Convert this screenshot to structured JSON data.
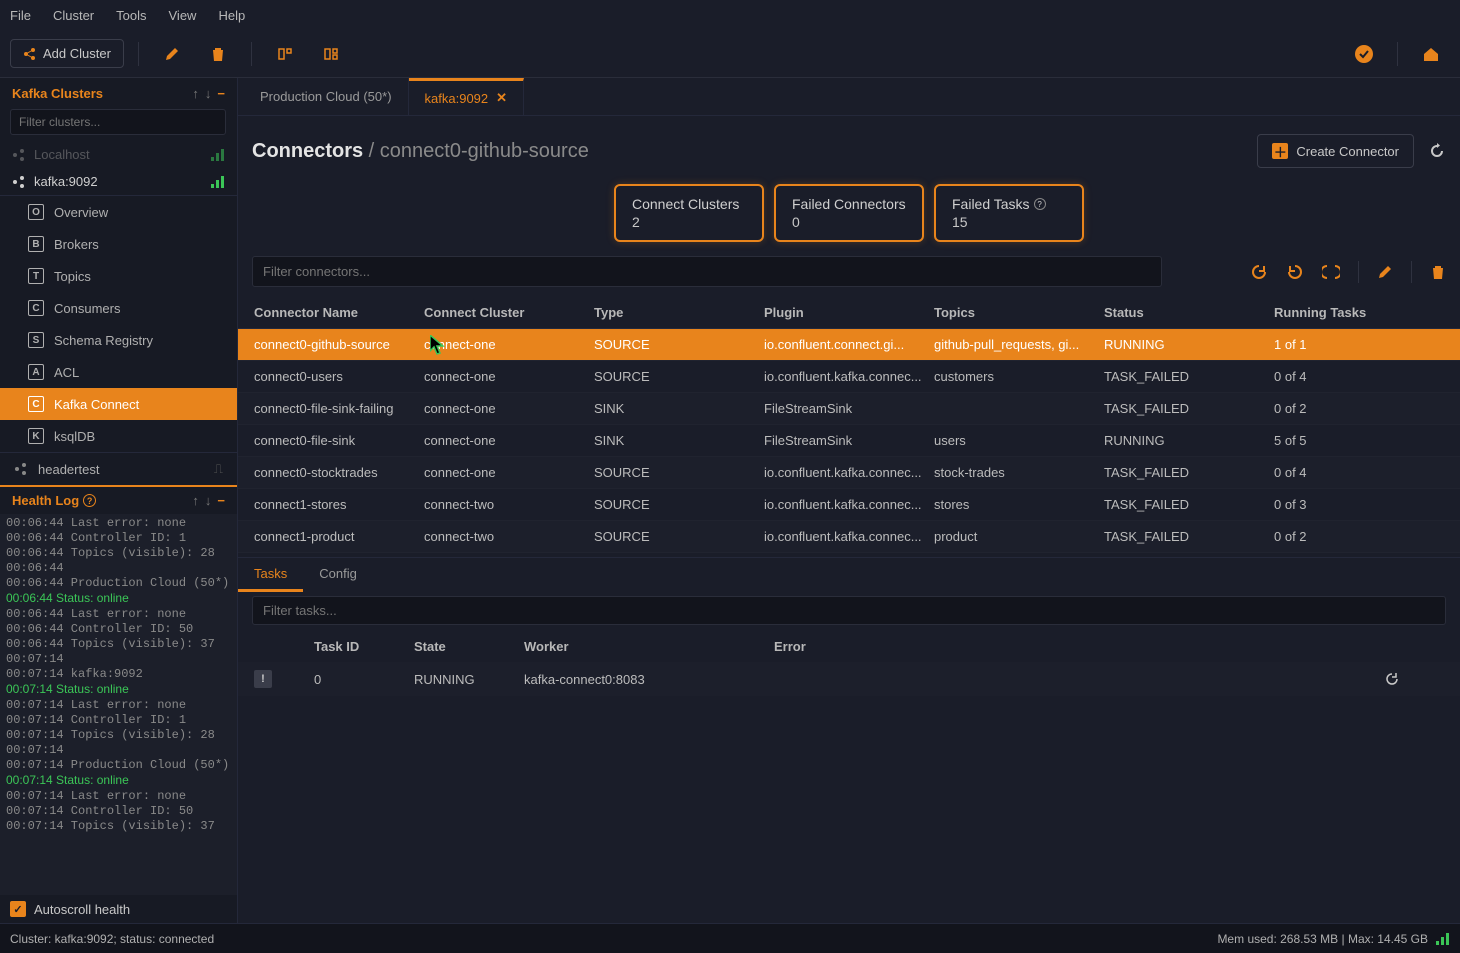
{
  "menu": {
    "file": "File",
    "cluster": "Cluster",
    "tools": "Tools",
    "view": "View",
    "help": "Help"
  },
  "toolbar": {
    "add_cluster": "Add Cluster"
  },
  "sidebar": {
    "title": "Kafka Clusters",
    "filter_placeholder": "Filter clusters...",
    "items": [
      {
        "name": "Localhost",
        "faded": true
      },
      {
        "name": "kafka:9092",
        "active": true
      }
    ],
    "tree": [
      {
        "badge": "O",
        "label": "Overview"
      },
      {
        "badge": "B",
        "label": "Brokers"
      },
      {
        "badge": "T",
        "label": "Topics"
      },
      {
        "badge": "C",
        "label": "Consumers"
      },
      {
        "badge": "S",
        "label": "Schema Registry"
      },
      {
        "badge": "A",
        "label": "ACL"
      },
      {
        "badge": "C",
        "label": "Kafka Connect",
        "selected": true
      },
      {
        "badge": "K",
        "label": "ksqlDB"
      }
    ],
    "headertest": "headertest",
    "health_title": "Health Log",
    "autoscroll": "Autoscroll health"
  },
  "health_log": [
    "00:06:44 Last error: none",
    "00:06:44 Controller ID: 1",
    "00:06:44 Topics (visible): 28",
    "00:06:44",
    "00:06:44 Production Cloud (50*)",
    {
      "g": "00:06:44 Status: online"
    },
    "00:06:44 Last error: none",
    "00:06:44 Controller ID: 50",
    "00:06:44 Topics (visible): 37",
    "00:07:14",
    "00:07:14 kafka:9092",
    {
      "g": "00:07:14 Status: online"
    },
    "00:07:14 Last error: none",
    "00:07:14 Controller ID: 1",
    "00:07:14 Topics (visible): 28",
    "00:07:14",
    "00:07:14 Production Cloud (50*)",
    {
      "g": "00:07:14 Status: online"
    },
    "00:07:14 Last error: none",
    "00:07:14 Controller ID: 50",
    "00:07:14 Topics (visible): 37"
  ],
  "tabs": [
    {
      "label": "Production Cloud (50*)",
      "active": false
    },
    {
      "label": "kafka:9092",
      "active": true
    }
  ],
  "page": {
    "title": "Connectors",
    "crumb_sep": " / ",
    "crumb": "connect0-github-source",
    "create": "Create Connector",
    "filter_placeholder": "Filter connectors..."
  },
  "stats": [
    {
      "label": "Connect Clusters",
      "value": "2"
    },
    {
      "label": "Failed Connectors",
      "value": "0"
    },
    {
      "label": "Failed Tasks",
      "value": "15",
      "info": true
    }
  ],
  "columns": [
    "Connector Name",
    "Connect Cluster",
    "Type",
    "Plugin",
    "Topics",
    "Status",
    "Running Tasks"
  ],
  "rows": [
    {
      "name": "connect0-github-source",
      "cluster": "connect-one",
      "type": "SOURCE",
      "plugin": "io.confluent.connect.gi...",
      "topics": "github-pull_requests, gi...",
      "status": "RUNNING",
      "tasks": "1 of 1",
      "selected": true
    },
    {
      "name": "connect0-users",
      "cluster": "connect-one",
      "type": "SOURCE",
      "plugin": "io.confluent.kafka.connec...",
      "topics": "customers",
      "status": "TASK_FAILED",
      "tasks": "0 of 4"
    },
    {
      "name": "connect0-file-sink-failing",
      "cluster": "connect-one",
      "type": "SINK",
      "plugin": "FileStreamSink",
      "topics": "",
      "status": "TASK_FAILED",
      "tasks": "0 of 2"
    },
    {
      "name": "connect0-file-sink",
      "cluster": "connect-one",
      "type": "SINK",
      "plugin": "FileStreamSink",
      "topics": "users",
      "status": "RUNNING",
      "tasks": "5 of 5"
    },
    {
      "name": "connect0-stocktrades",
      "cluster": "connect-one",
      "type": "SOURCE",
      "plugin": "io.confluent.kafka.connec...",
      "topics": "stock-trades",
      "status": "TASK_FAILED",
      "tasks": "0 of 4"
    },
    {
      "name": "connect1-stores",
      "cluster": "connect-two",
      "type": "SOURCE",
      "plugin": "io.confluent.kafka.connec...",
      "topics": "stores",
      "status": "TASK_FAILED",
      "tasks": "0 of 3"
    },
    {
      "name": "connect1-product",
      "cluster": "connect-two",
      "type": "SOURCE",
      "plugin": "io.confluent.kafka.connec...",
      "topics": "product",
      "status": "TASK_FAILED",
      "tasks": "0 of 2"
    }
  ],
  "subtabs": [
    {
      "label": "Tasks",
      "active": true
    },
    {
      "label": "Config",
      "active": false
    }
  ],
  "task_filter_placeholder": "Filter tasks...",
  "task_columns": [
    "",
    "Task ID",
    "State",
    "Worker",
    "Error",
    ""
  ],
  "task_rows": [
    {
      "id": "0",
      "state": "RUNNING",
      "worker": "kafka-connect0:8083",
      "error": ""
    }
  ],
  "status": {
    "left": "Cluster: kafka:9092; status: connected",
    "right": "Mem used: 268.53 MB | Max: 14.45 GB"
  }
}
